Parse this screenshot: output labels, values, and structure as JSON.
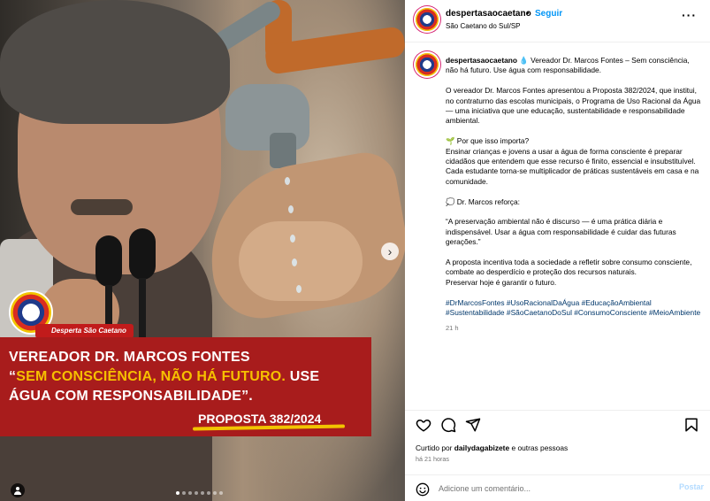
{
  "header": {
    "username": "despertasaocaetano",
    "separator": "•",
    "follow_label": "Seguir",
    "location": "São Caetano do Sul/SP",
    "more_label": "···"
  },
  "media": {
    "brand_ribbon": "Desperta São Caetano",
    "quote_line1": "VEREADOR DR. MARCOS FONTES",
    "quote_line2_pre": "“",
    "quote_line2_hl": "SEM CONSCIÊNCIA, NÃO HÁ FUTURO.",
    "quote_line2_post": " USE",
    "quote_line3": "ÁGUA COM RESPONSABILIDADE”.",
    "proposal": "PROPOSTA 382/2024",
    "next_label": "›",
    "user_tag_icon": "person-icon",
    "carousel_total": 8,
    "carousel_active": 1
  },
  "caption": {
    "username": "despertasaocaetano",
    "intro": " 💧 Vereador Dr. Marcos Fontes – Sem consciência, não há futuro. Use água com responsabilidade.",
    "p1": "O vereador Dr. Marcos Fontes apresentou a Proposta 382/2024, que institui, no contraturno das escolas municipais, o Programa de Uso Racional da Água — uma iniciativa que une educação, sustentabilidade e responsabilidade ambiental.",
    "p2_title": "🌱 Por que isso importa?",
    "p2": "Ensinar crianças e jovens a usar a água de forma consciente é preparar cidadãos que entendem que esse recurso é finito, essencial e insubstituível. Cada estudante torna-se multiplicador de práticas sustentáveis em casa e na comunidade.",
    "p3_title": "💭 Dr. Marcos reforça:",
    "p3": "“A preservação ambiental não é discurso — é uma prática diária e indispensável. Usar a água com responsabilidade é cuidar das futuras gerações.”",
    "p4a": "A proposta incentiva toda a sociedade a refletir sobre consumo consciente, combate ao desperdício e proteção dos recursos naturais.",
    "p4b": "Preservar hoje é garantir o futuro.",
    "hashtags": "#DrMarcosFontes #UsoRacionalDaÁgua #EducaçãoAmbiental #Sustentabilidade #SãoCaetanoDoSul #ConsumoConsciente #MeioAmbiente",
    "time": "21 h"
  },
  "footer": {
    "liked_prefix": "Curtido por ",
    "liked_user": "dailydagabizete",
    "liked_suffix": " e outras pessoas",
    "posted_ago": "há 21 horas",
    "comment_placeholder": "Adicione um comentário...",
    "post_label": "Postar"
  },
  "colors": {
    "accent_blue": "#0095f6",
    "banner_red": "#a81c1c",
    "highlight_yellow": "#f6c000",
    "hashtag_blue": "#00376b"
  }
}
